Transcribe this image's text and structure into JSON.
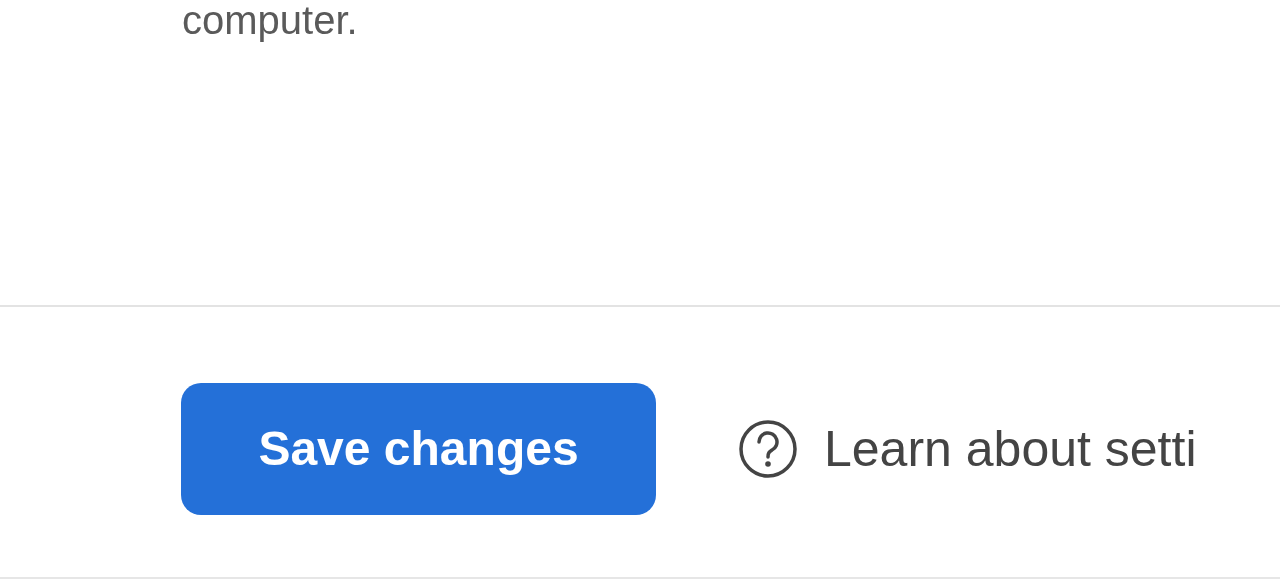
{
  "description_text": "computer.",
  "footer": {
    "save_button": {
      "label": "Save changes"
    },
    "help_link": {
      "label": "Learn about setti"
    }
  }
}
